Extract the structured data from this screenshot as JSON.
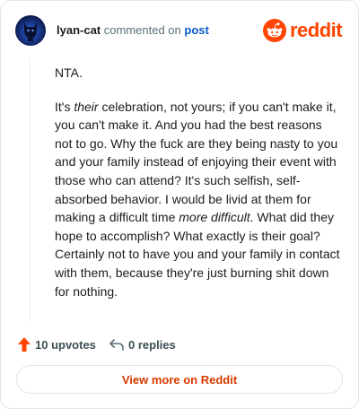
{
  "header": {
    "username": "lyan-cat",
    "action_text": "commented on",
    "post_link": "post",
    "logo_text": "reddit",
    "avatar_icon": "cat-silhouette-icon",
    "logo_icon": "reddit-snoo-icon"
  },
  "comment": {
    "p1": "NTA.",
    "p2_start": "It's ",
    "p2_em1": "their",
    "p2_mid": " celebration, not yours; if you can't make it, you can't make it. And you had the best reasons not to go. Why the fuck are they being nasty to you and your family instead of enjoying their event with those who can attend? It's such selfish, self-absorbed behavior. I would be livid at them for making a difficult time ",
    "p2_em2": "more difficult",
    "p2_end": ". What did they hope to accomplish? What exactly is their goal? Certainly not to have you and your family in contact with them, because they're just burning shit down for nothing."
  },
  "footer": {
    "upvotes": "10 upvotes",
    "replies": "0 replies",
    "upvote_icon": "upvote-arrow-icon",
    "reply_icon": "reply-arrow-icon"
  },
  "cta": {
    "view_more": "View more on Reddit"
  },
  "colors": {
    "brand": "#ff4500",
    "link": "#0a59c9",
    "cta_text": "#d93a00"
  }
}
